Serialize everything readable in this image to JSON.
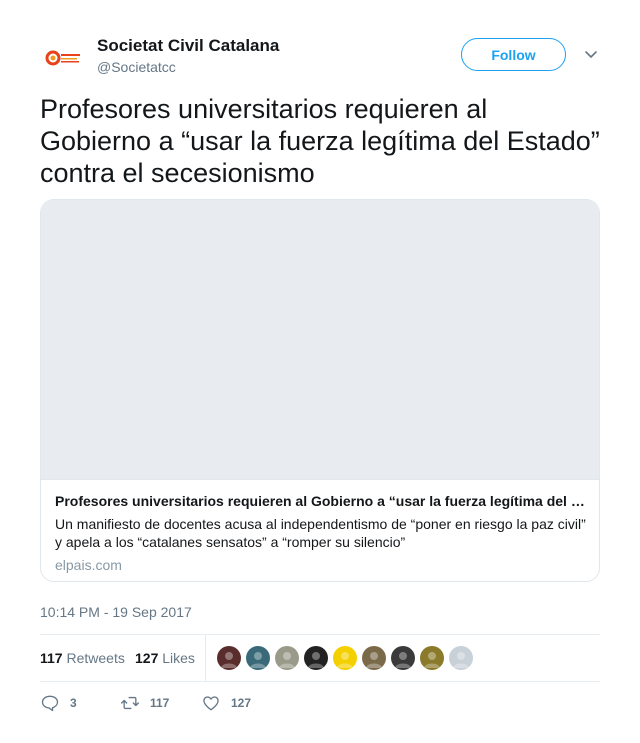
{
  "account": {
    "display_name": "Societat Civil Catalana",
    "handle": "@Societatcc"
  },
  "follow_label": "Follow",
  "tweet": {
    "text": "Profesores universitarios requieren al Gobierno a “usar la fuerza legítima del Estado” contra el secesionismo",
    "timestamp": "10:14 PM - 19 Sep 2017"
  },
  "card": {
    "title": "Profesores universitarios requieren al Gobierno a “usar la fuerza legítima del …",
    "description": "Un manifiesto de docentes acusa al independentismo de “poner en riesgo la paz civil” y apela a los “catalanes sensatos” a “romper su silencio”",
    "domain": "elpais.com"
  },
  "stats": {
    "retweets_count": "117",
    "retweets_label": "Retweets",
    "likes_count": "127",
    "likes_label": "Likes"
  },
  "actions": {
    "reply_count": "3",
    "retweet_count": "117",
    "like_count": "127"
  },
  "likers": [
    {
      "icon": "liker-avatar",
      "color": "#5a2d2d"
    },
    {
      "icon": "liker-avatar",
      "color": "#3a6a7a"
    },
    {
      "icon": "liker-avatar",
      "color": "#9a9a8a"
    },
    {
      "icon": "liker-avatar",
      "color": "#222222"
    },
    {
      "icon": "liker-avatar",
      "color": "#f5d000"
    },
    {
      "icon": "liker-avatar",
      "color": "#7a6a4a"
    },
    {
      "icon": "liker-avatar",
      "color": "#3a3a3a"
    },
    {
      "icon": "liker-avatar",
      "color": "#8a7a2a"
    },
    {
      "icon": "liker-avatar",
      "color": "#c8d0d8"
    }
  ],
  "colors": {
    "accent": "#1da1f2",
    "text": "#14171a",
    "muted": "#657786"
  }
}
